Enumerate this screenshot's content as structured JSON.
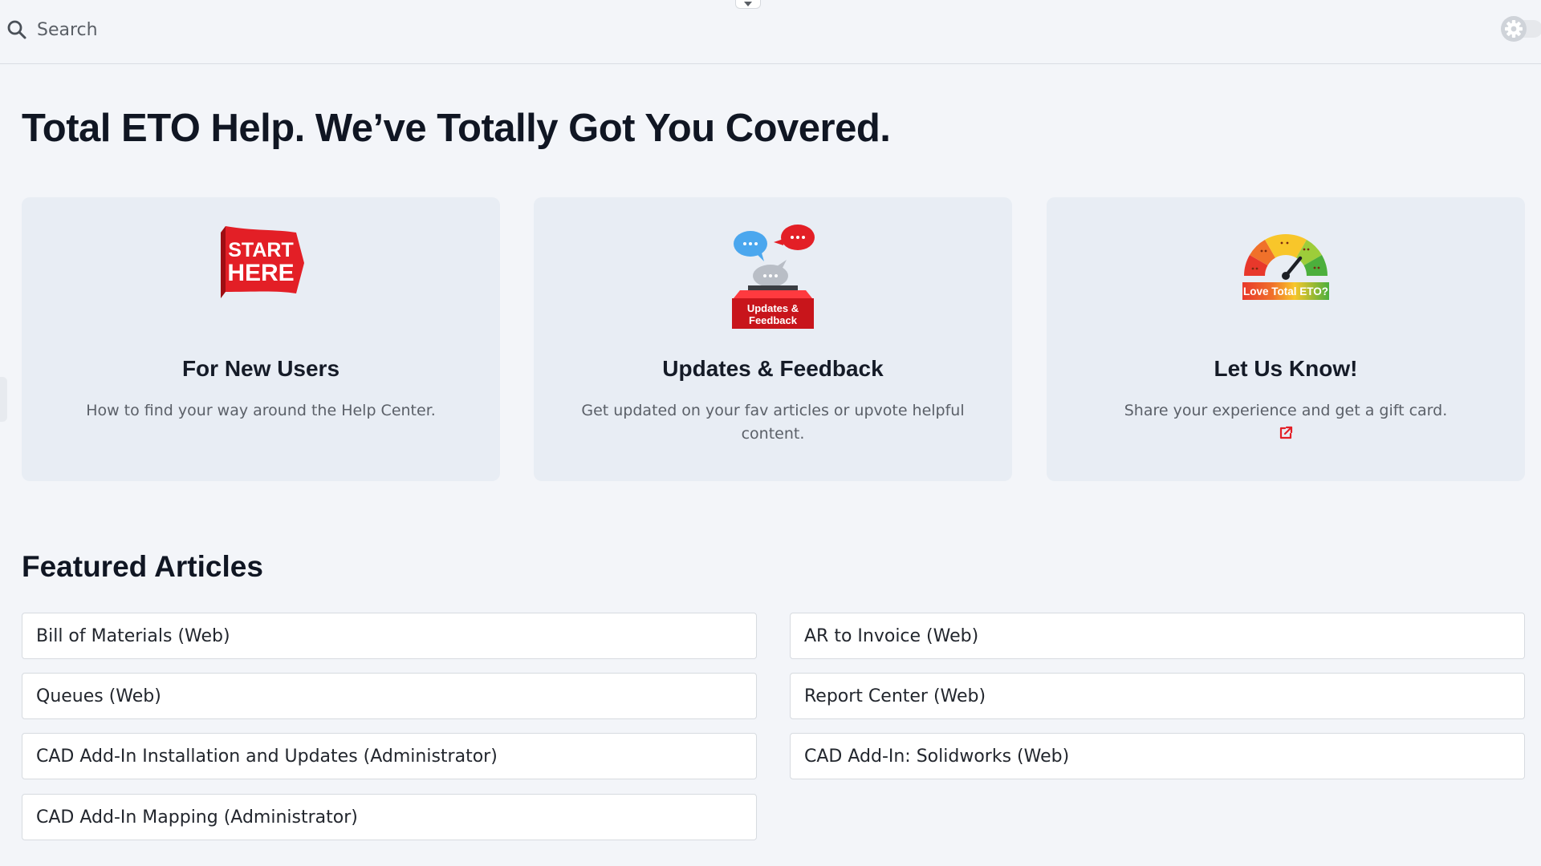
{
  "search": {
    "placeholder": "Search"
  },
  "page": {
    "title": "Total ETO Help. We’ve Totally Got You Covered."
  },
  "cards": [
    {
      "icon": "start-here-banner-icon",
      "icon_text": [
        "START",
        "HERE"
      ],
      "title": "For New Users",
      "description": "How to find your way around the Help Center."
    },
    {
      "icon": "updates-feedback-ballot-box-icon",
      "icon_text": [
        "Updates &",
        "Feedback"
      ],
      "title": "Updates & Feedback",
      "description": "Get updated on your fav articles or upvote helpful content."
    },
    {
      "icon": "satisfaction-gauge-icon",
      "icon_text": [
        "Love Total ETO?"
      ],
      "title": "Let Us Know!",
      "description": "Share your experience and get a gift card.",
      "link_icon": "external-link-icon"
    }
  ],
  "featured": {
    "title": "Featured Articles",
    "articles": [
      "Bill of Materials (Web)",
      "AR to Invoice (Web)",
      "Queues (Web)",
      "Report Center (Web)",
      "CAD Add-In Installation and Updates (Administrator)",
      "CAD Add-In: Solidworks (Web)",
      "CAD Add-In Mapping (Administrator)"
    ]
  },
  "colors": {
    "background": "#f3f5f9",
    "card": "#e8edf4",
    "accent_red": "#e31f26",
    "bubble_blue": "#4ba7ee"
  }
}
